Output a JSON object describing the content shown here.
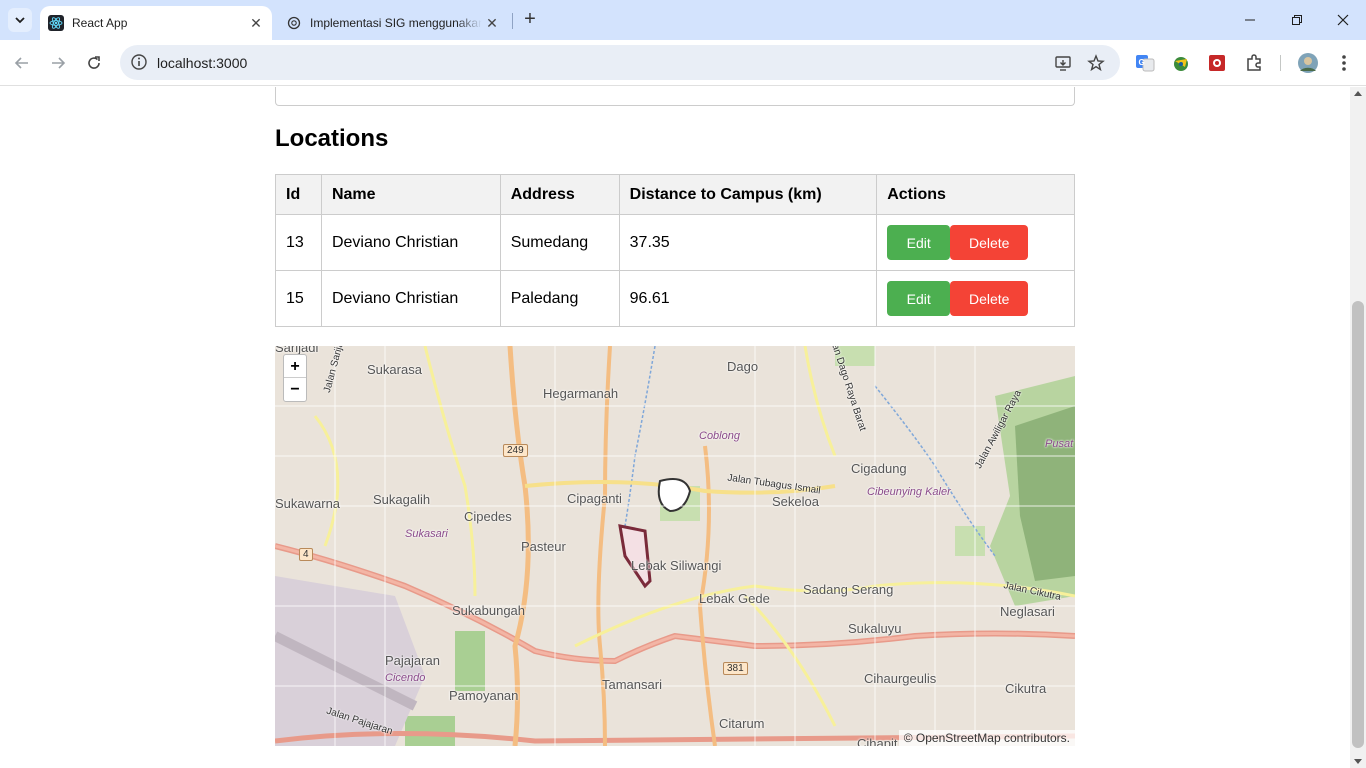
{
  "browser": {
    "tabs": [
      {
        "title": "React App",
        "active": true
      },
      {
        "title": "Implementasi SIG menggunakan",
        "active": false
      }
    ],
    "url": "localhost:3000"
  },
  "page": {
    "heading": "Locations",
    "table": {
      "headers": [
        "Id",
        "Name",
        "Address",
        "Distance to Campus (km)",
        "Actions"
      ],
      "rows": [
        {
          "id": "13",
          "name": "Deviano Christian",
          "address": "Sumedang",
          "distance": "37.35"
        },
        {
          "id": "15",
          "name": "Deviano Christian",
          "address": "Paledang",
          "distance": "96.61"
        }
      ],
      "edit_label": "Edit",
      "delete_label": "Delete"
    },
    "map": {
      "zoom_in": "+",
      "zoom_out": "−",
      "attribution": "© OpenStreetMap contributors.",
      "labels": [
        "Sukarasa",
        "Hegarmanah",
        "Dago",
        "Coblong",
        "Cigadung",
        "Sukawarna",
        "Sukagalih",
        "Cipaganti",
        "Sekeloa",
        "Cipedes",
        "Sukasari",
        "Pasteur",
        "Cibeunying Kaler",
        "Lebak Siliwangi",
        "Sadang Serang",
        "Sukabungah",
        "Lebak Gede",
        "Neglasari",
        "Sukaluyu",
        "Pajajaran",
        "Cicendo",
        "Pamoyanan",
        "Tamansari",
        "Cihaurgeulis",
        "Cikutra",
        "Citarum",
        "Cihapit",
        "Jalan Tubagus Ismail",
        "Jalan Cikutra",
        "Jalan Awiligar Raya",
        "Jalan Dago Raya Barat",
        "Jalan Pajajaran",
        "Jalan Sarijadi",
        "Sarijadi",
        "Pusat"
      ],
      "shields": [
        "249",
        "381",
        "4"
      ]
    }
  }
}
